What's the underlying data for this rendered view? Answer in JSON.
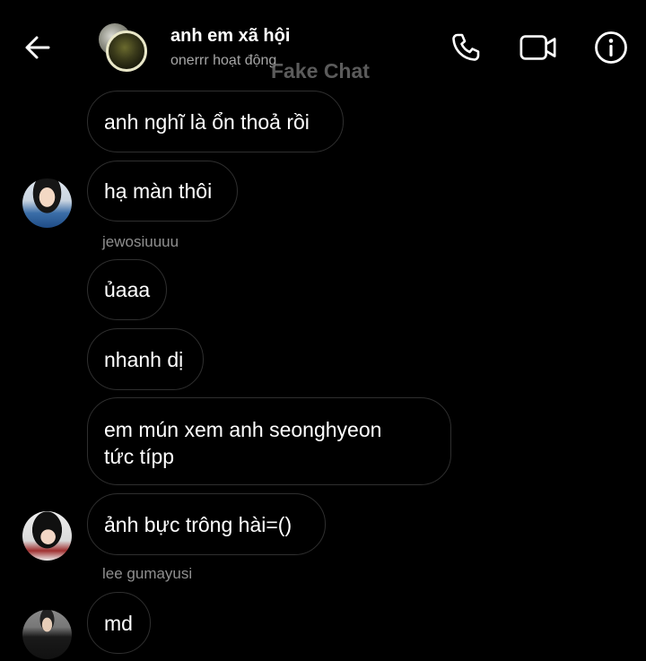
{
  "header": {
    "title": "anh em xã hội",
    "subtitle": "onerrr hoạt động",
    "watermark": "Fake Chat"
  },
  "icons": {
    "back": "back-arrow-icon",
    "call": "phone-icon",
    "video": "video-camera-icon",
    "info": "info-icon"
  },
  "colors": {
    "background": "#000000",
    "bubble_border": "#2f2f2f",
    "text": "#ffffff",
    "muted": "#8f8f8f"
  },
  "messages": [
    {
      "text": "anh nghĩ là ổn thoả rồi"
    },
    {
      "text": "hạ màn thôi"
    },
    {
      "sender": "jewosiuuuu"
    },
    {
      "text": "ủaaa"
    },
    {
      "text": "nhanh dị"
    },
    {
      "text": "em mún xem anh seonghyeon\ntức típp"
    },
    {
      "text": "ảnh bực trông hài=()"
    },
    {
      "sender": "lee gumayusi"
    },
    {
      "text": "md"
    }
  ]
}
